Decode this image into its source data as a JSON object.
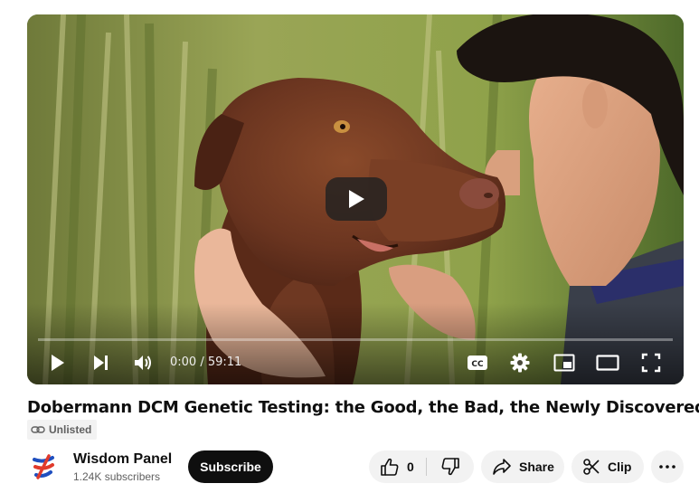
{
  "player": {
    "time_display": "0:00 / 59:11",
    "progress": 0,
    "controls": {
      "play": "play-icon",
      "next": "next-icon",
      "volume": "volume-icon",
      "captions": "cc-icon",
      "settings": "gear-icon",
      "miniplayer": "miniplayer-icon",
      "theater": "theater-icon",
      "fullscreen": "fullscreen-icon"
    }
  },
  "video": {
    "title": "Dobermann DCM Genetic Testing: the Good, the Bad, the Newly Discovered",
    "visibility_badge": "Unlisted",
    "visibility_icon": "link-icon"
  },
  "channel": {
    "name": "Wisdom Panel",
    "subscribers": "1.24K subscribers",
    "subscribe_label": "Subscribe"
  },
  "actions": {
    "like_count": "0",
    "share_label": "Share",
    "clip_label": "Clip"
  },
  "colors": {
    "progress": "#ff0000",
    "subscribe_bg": "#0f0f0f",
    "pill_bg": "#f2f2f2",
    "logo_blue": "#1f4fbf",
    "logo_red": "#e03a2b"
  }
}
